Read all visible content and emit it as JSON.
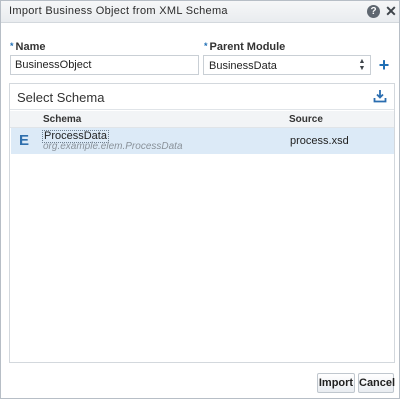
{
  "dialog": {
    "title": "Import Business Object from XML Schema",
    "help_icon": "question-circle-icon",
    "close_icon": "close-icon"
  },
  "form": {
    "name_label": "Name",
    "name_value": "BusinessObject",
    "module_label": "Parent Module",
    "module_value": "BusinessData",
    "required_marker": "*",
    "add_icon": "plus-icon"
  },
  "schema_panel": {
    "title": "Select Schema",
    "download_icon": "download-icon",
    "columns": [
      "Schema",
      "Source"
    ],
    "rows": [
      {
        "type_icon": "E",
        "name": "ProcessData",
        "namespace": "org.example.elem.ProcessData",
        "source": "process.xsd"
      }
    ]
  },
  "buttons": {
    "import": "Import",
    "cancel": "Cancel"
  },
  "colors": {
    "accent": "#1f6fb5",
    "selected_row": "#dceaf7"
  }
}
